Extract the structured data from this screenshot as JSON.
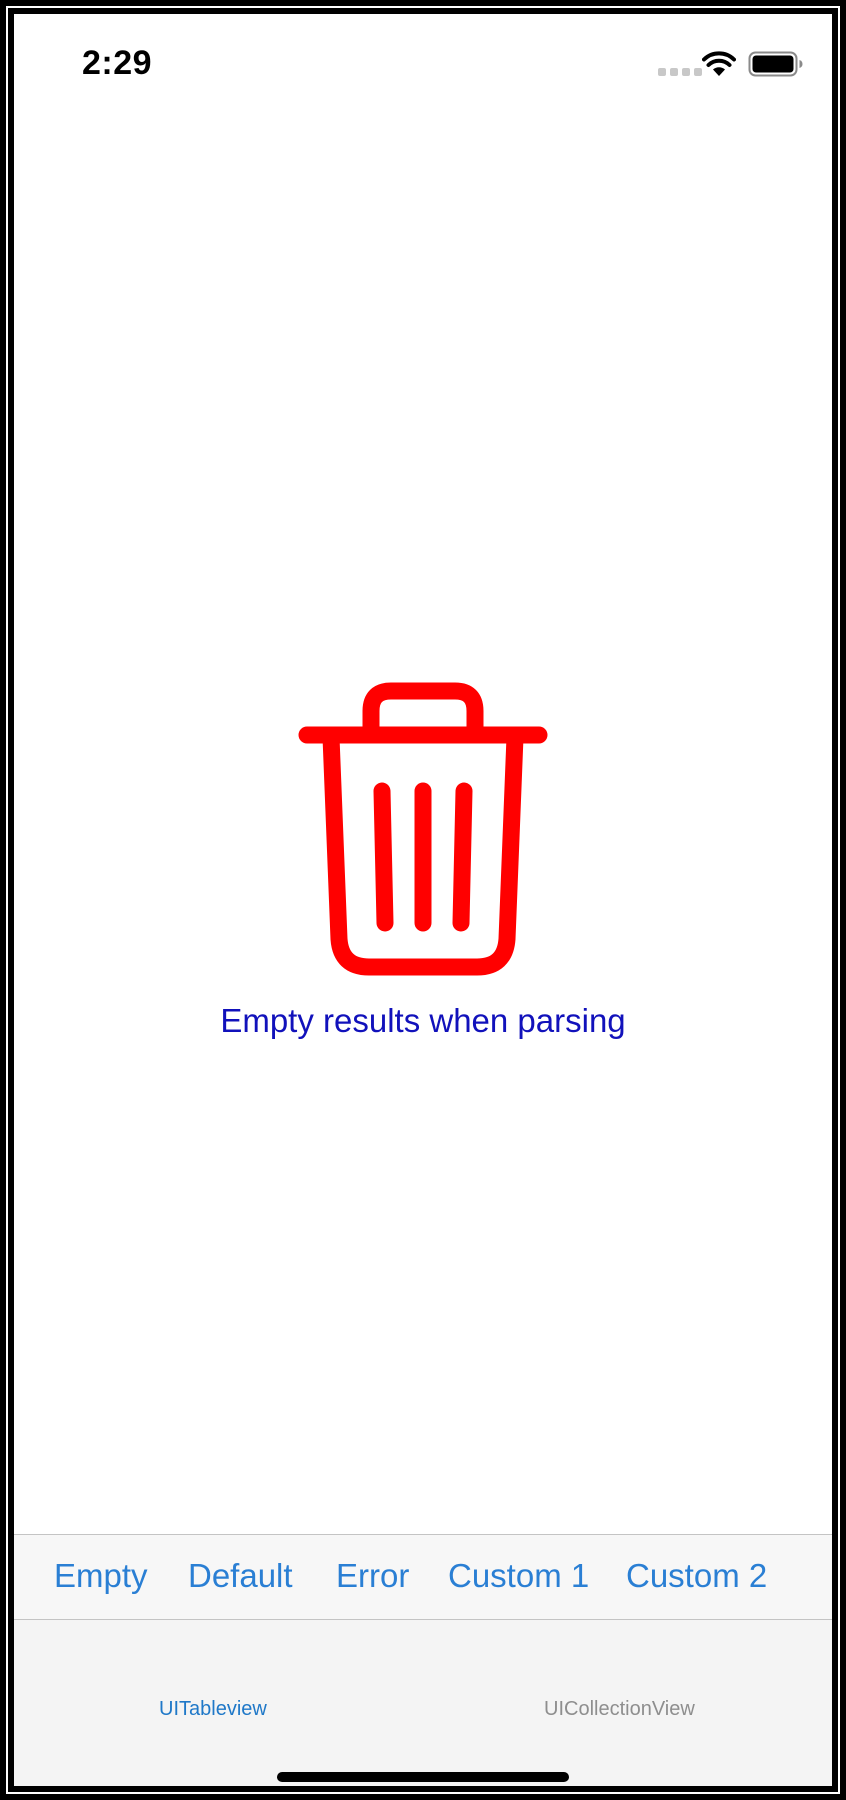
{
  "status_bar": {
    "time": "2:29",
    "icons": [
      "cellular-signal-icon",
      "wifi-icon",
      "battery-icon"
    ]
  },
  "empty_state": {
    "icon": "trash-icon",
    "icon_color": "#ff0000",
    "message": "Empty results when parsing",
    "message_color": "#1111bb"
  },
  "options": {
    "accent_color": "#2a7fd4",
    "items": [
      {
        "label": "Empty"
      },
      {
        "label": "Default"
      },
      {
        "label": "Error"
      },
      {
        "label": "Custom 1"
      },
      {
        "label": "Custom 2"
      }
    ]
  },
  "tab_bar": {
    "tabs": [
      {
        "label": "UITableview",
        "selected": true
      },
      {
        "label": "UICollectionView",
        "selected": false
      }
    ]
  }
}
